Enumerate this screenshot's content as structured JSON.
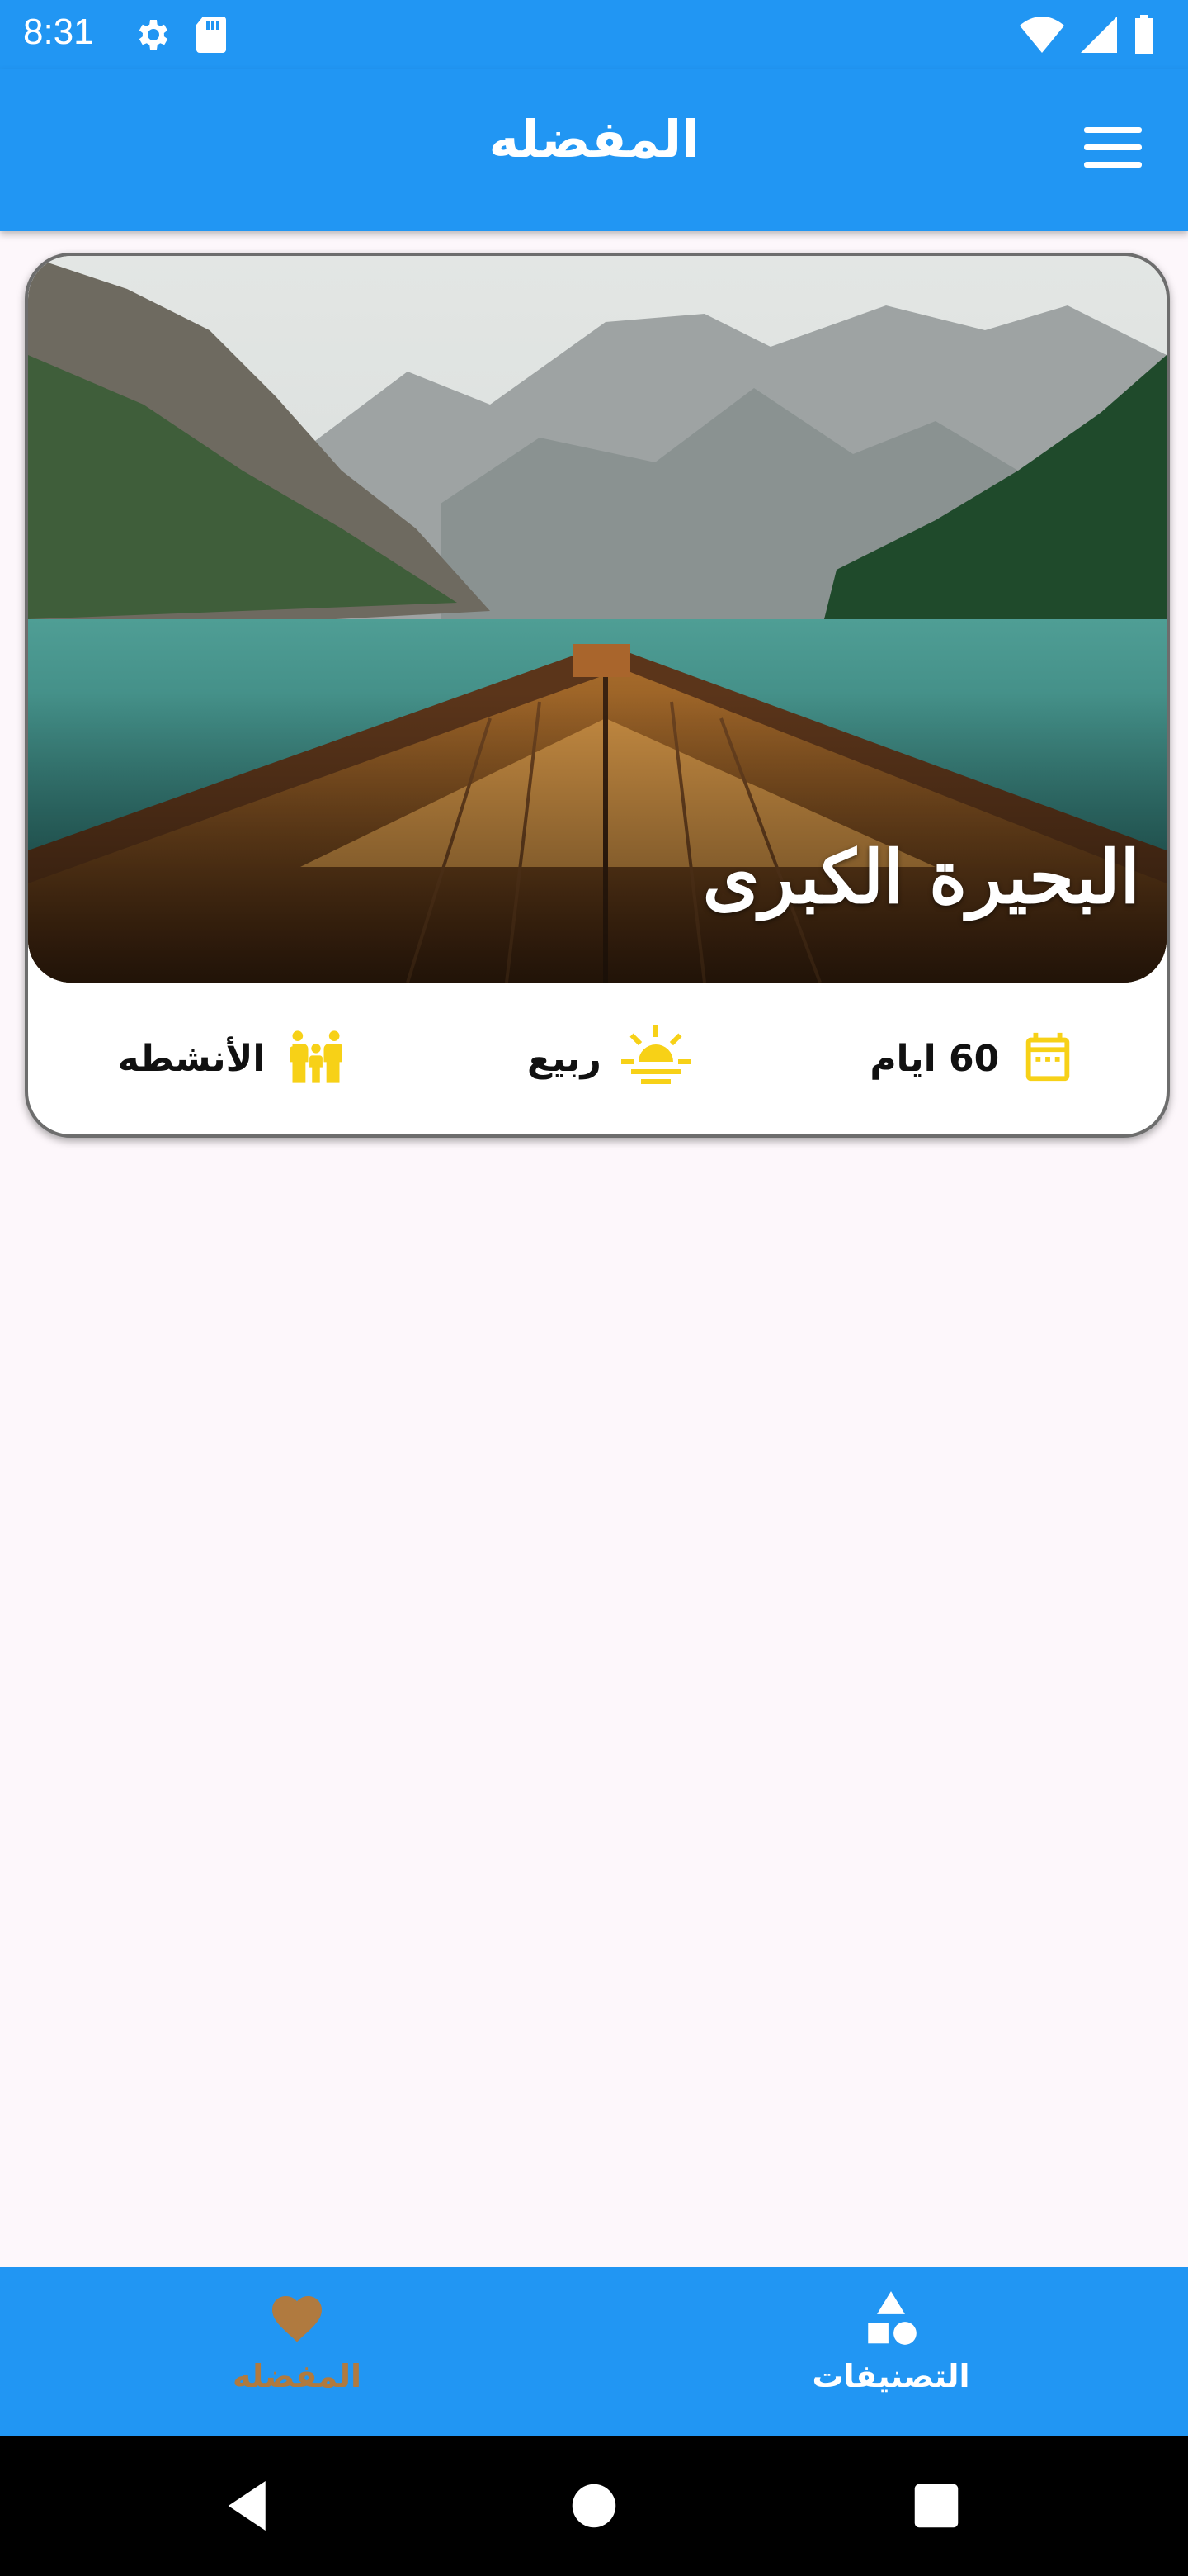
{
  "status": {
    "time": "8:31",
    "icons_left": [
      "gear-icon",
      "sd-card-icon"
    ],
    "icons_right": [
      "wifi-icon",
      "signal-icon",
      "battery-icon"
    ]
  },
  "app_bar": {
    "title": "المفضله"
  },
  "card": {
    "title": "البحيرة الكبرى",
    "duration": "60 ايام",
    "season": "ربيع",
    "activities": "الأنشطه",
    "icon_color": "#f7d117"
  },
  "bottom_nav": {
    "favorites_label": "المفضله",
    "categories_label": "التصنيفات",
    "active_color": "#b07a3f",
    "background": "#2196f3"
  },
  "colors": {
    "primary": "#2196f3",
    "background": "#fdf7fb"
  }
}
